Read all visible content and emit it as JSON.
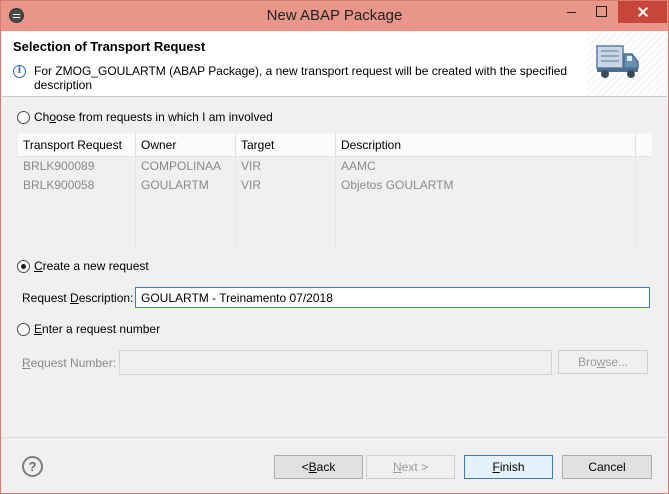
{
  "window": {
    "title": "New ABAP Package"
  },
  "header": {
    "title": "Selection of Transport Request",
    "message": "For ZMOG_GOULARTM (ABAP Package), a new transport request will be created with the specified description",
    "truck_icon": "transport-truck-icon"
  },
  "options": {
    "choose_label_pre": "Ch",
    "choose_label_u": "o",
    "choose_label_post": "ose from requests in which I am involved",
    "create_label_u": "C",
    "create_label_post": "reate a new request",
    "enter_label_u": "E",
    "enter_label_post": "nter a request number",
    "selected": "create"
  },
  "table": {
    "columns": [
      "Transport Request",
      "Owner",
      "Target",
      "Description"
    ],
    "rows": [
      [
        "BRLK900089",
        "COMPOLINAA",
        "VIR",
        "AAMC"
      ],
      [
        "BRLK900058",
        "GOULARTM",
        "VIR",
        "Objetos GOULARTM"
      ]
    ]
  },
  "request_description": {
    "label_pre": "Request ",
    "label_u": "D",
    "label_post": "escription:",
    "value": "GOULARTM - Treinamento 07/2018"
  },
  "request_number": {
    "label_u": "R",
    "label_post": "equest Number:",
    "value": "",
    "browse_pre": "Bro",
    "browse_u": "w",
    "browse_post": "se..."
  },
  "buttons": {
    "back_pre": "< ",
    "back_u": "B",
    "back_post": "ack",
    "next_u": "N",
    "next_post": "ext >",
    "finish_u": "F",
    "finish_post": "inish",
    "cancel": "Cancel"
  },
  "colors": {
    "titlebar": "#e8958a",
    "close_button": "#c7463a",
    "focus_border": "#3d7bd9",
    "default_button": "#3c7fb1"
  }
}
